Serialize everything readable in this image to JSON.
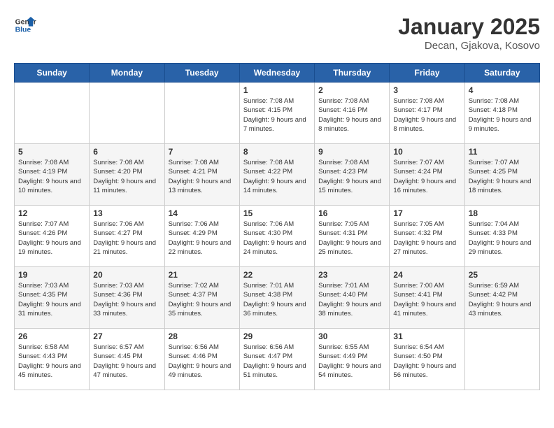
{
  "header": {
    "logo_general": "General",
    "logo_blue": "Blue",
    "title": "January 2025",
    "subtitle": "Decan, Gjakova, Kosovo"
  },
  "weekdays": [
    "Sunday",
    "Monday",
    "Tuesday",
    "Wednesday",
    "Thursday",
    "Friday",
    "Saturday"
  ],
  "weeks": [
    [
      {
        "day": null
      },
      {
        "day": null
      },
      {
        "day": null
      },
      {
        "day": "1",
        "sunrise": "7:08 AM",
        "sunset": "4:15 PM",
        "daylight": "9 hours and 7 minutes."
      },
      {
        "day": "2",
        "sunrise": "7:08 AM",
        "sunset": "4:16 PM",
        "daylight": "9 hours and 8 minutes."
      },
      {
        "day": "3",
        "sunrise": "7:08 AM",
        "sunset": "4:17 PM",
        "daylight": "9 hours and 8 minutes."
      },
      {
        "day": "4",
        "sunrise": "7:08 AM",
        "sunset": "4:18 PM",
        "daylight": "9 hours and 9 minutes."
      }
    ],
    [
      {
        "day": "5",
        "sunrise": "7:08 AM",
        "sunset": "4:19 PM",
        "daylight": "9 hours and 10 minutes."
      },
      {
        "day": "6",
        "sunrise": "7:08 AM",
        "sunset": "4:20 PM",
        "daylight": "9 hours and 11 minutes."
      },
      {
        "day": "7",
        "sunrise": "7:08 AM",
        "sunset": "4:21 PM",
        "daylight": "9 hours and 13 minutes."
      },
      {
        "day": "8",
        "sunrise": "7:08 AM",
        "sunset": "4:22 PM",
        "daylight": "9 hours and 14 minutes."
      },
      {
        "day": "9",
        "sunrise": "7:08 AM",
        "sunset": "4:23 PM",
        "daylight": "9 hours and 15 minutes."
      },
      {
        "day": "10",
        "sunrise": "7:07 AM",
        "sunset": "4:24 PM",
        "daylight": "9 hours and 16 minutes."
      },
      {
        "day": "11",
        "sunrise": "7:07 AM",
        "sunset": "4:25 PM",
        "daylight": "9 hours and 18 minutes."
      }
    ],
    [
      {
        "day": "12",
        "sunrise": "7:07 AM",
        "sunset": "4:26 PM",
        "daylight": "9 hours and 19 minutes."
      },
      {
        "day": "13",
        "sunrise": "7:06 AM",
        "sunset": "4:27 PM",
        "daylight": "9 hours and 21 minutes."
      },
      {
        "day": "14",
        "sunrise": "7:06 AM",
        "sunset": "4:29 PM",
        "daylight": "9 hours and 22 minutes."
      },
      {
        "day": "15",
        "sunrise": "7:06 AM",
        "sunset": "4:30 PM",
        "daylight": "9 hours and 24 minutes."
      },
      {
        "day": "16",
        "sunrise": "7:05 AM",
        "sunset": "4:31 PM",
        "daylight": "9 hours and 25 minutes."
      },
      {
        "day": "17",
        "sunrise": "7:05 AM",
        "sunset": "4:32 PM",
        "daylight": "9 hours and 27 minutes."
      },
      {
        "day": "18",
        "sunrise": "7:04 AM",
        "sunset": "4:33 PM",
        "daylight": "9 hours and 29 minutes."
      }
    ],
    [
      {
        "day": "19",
        "sunrise": "7:03 AM",
        "sunset": "4:35 PM",
        "daylight": "9 hours and 31 minutes."
      },
      {
        "day": "20",
        "sunrise": "7:03 AM",
        "sunset": "4:36 PM",
        "daylight": "9 hours and 33 minutes."
      },
      {
        "day": "21",
        "sunrise": "7:02 AM",
        "sunset": "4:37 PM",
        "daylight": "9 hours and 35 minutes."
      },
      {
        "day": "22",
        "sunrise": "7:01 AM",
        "sunset": "4:38 PM",
        "daylight": "9 hours and 36 minutes."
      },
      {
        "day": "23",
        "sunrise": "7:01 AM",
        "sunset": "4:40 PM",
        "daylight": "9 hours and 38 minutes."
      },
      {
        "day": "24",
        "sunrise": "7:00 AM",
        "sunset": "4:41 PM",
        "daylight": "9 hours and 41 minutes."
      },
      {
        "day": "25",
        "sunrise": "6:59 AM",
        "sunset": "4:42 PM",
        "daylight": "9 hours and 43 minutes."
      }
    ],
    [
      {
        "day": "26",
        "sunrise": "6:58 AM",
        "sunset": "4:43 PM",
        "daylight": "9 hours and 45 minutes."
      },
      {
        "day": "27",
        "sunrise": "6:57 AM",
        "sunset": "4:45 PM",
        "daylight": "9 hours and 47 minutes."
      },
      {
        "day": "28",
        "sunrise": "6:56 AM",
        "sunset": "4:46 PM",
        "daylight": "9 hours and 49 minutes."
      },
      {
        "day": "29",
        "sunrise": "6:56 AM",
        "sunset": "4:47 PM",
        "daylight": "9 hours and 51 minutes."
      },
      {
        "day": "30",
        "sunrise": "6:55 AM",
        "sunset": "4:49 PM",
        "daylight": "9 hours and 54 minutes."
      },
      {
        "day": "31",
        "sunrise": "6:54 AM",
        "sunset": "4:50 PM",
        "daylight": "9 hours and 56 minutes."
      },
      {
        "day": null
      }
    ]
  ]
}
